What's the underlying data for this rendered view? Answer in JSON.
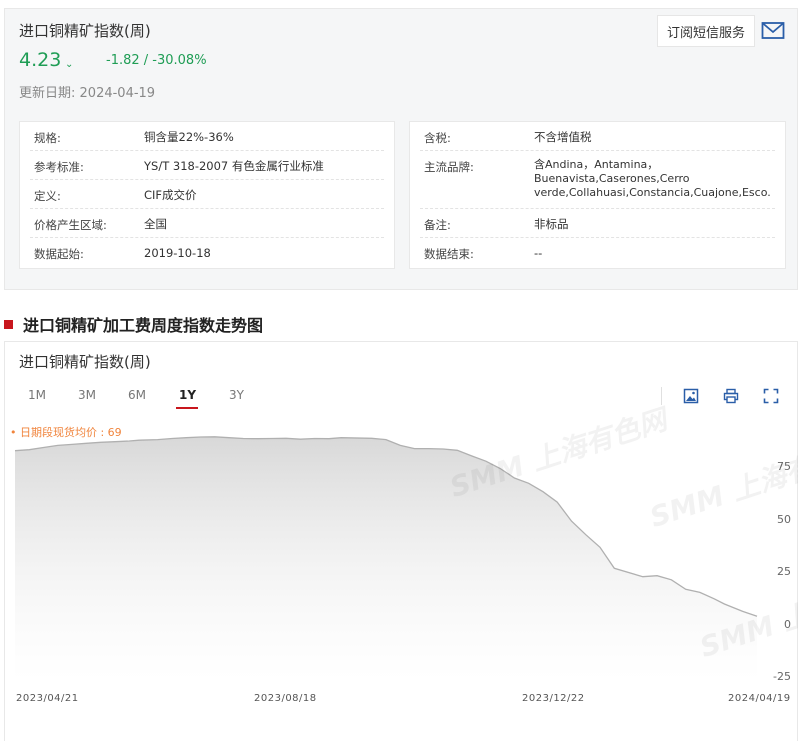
{
  "header": {
    "title": "进口铜精矿指数(周)",
    "price": "4.23",
    "change": "-1.82  /  -30.08%",
    "update_label": "更新日期:",
    "update_date": "2024-04-19",
    "subscribe_label": "订阅短信服务"
  },
  "info_left": [
    {
      "label": "规格:",
      "value": "铜含量22%-36%"
    },
    {
      "label": "参考标准:",
      "value": "YS/T 318-2007 有色金属行业标准"
    },
    {
      "label": "定义:",
      "value": "CIF成交价"
    },
    {
      "label": "价格产生区域:",
      "value": "全国"
    },
    {
      "label": "数据起始:",
      "value": "2019-10-18"
    }
  ],
  "info_right": [
    {
      "label": "含税:",
      "value": "不含增值税"
    },
    {
      "label": "主流品牌:",
      "value": "含Andina，Antamina，Buenavista,Caserones,Cerro verde,Collahuasi,Constancia,Cuajone,Esco..."
    },
    {
      "label": "备注:",
      "value": "非标品"
    },
    {
      "label": "数据结束:",
      "value": "--"
    }
  ],
  "section": {
    "title": "进口铜精矿加工费周度指数走势图"
  },
  "chart_panel": {
    "title": "进口铜精矿指数(周)",
    "ranges": [
      "1M",
      "3M",
      "6M",
      "1Y",
      "3Y"
    ],
    "active_range": "1Y",
    "avg_label": "• 日期段现货均价 : 69",
    "watermark": "SMM 上海有色网"
  },
  "icons": [
    "mail-icon",
    "image-download-icon",
    "print-icon",
    "fullscreen-icon"
  ],
  "colors": {
    "positive_change": "#1f9d55",
    "accent": "#c8161d",
    "avg_label": "#f0843c",
    "line": "#b0b0b0"
  },
  "chart_data": {
    "type": "area",
    "title": "进口铜精矿指数(周)",
    "x_ticks": [
      "2023/04/21",
      "2023/08/18",
      "2023/12/22",
      "2024/04/19"
    ],
    "y_ticks": [
      75,
      50,
      25,
      0,
      -25
    ],
    "ylim": [
      -25,
      90
    ],
    "grid": false,
    "average": 69,
    "x": [
      "2023-04-21",
      "2023-04-28",
      "2023-05-05",
      "2023-05-12",
      "2023-05-19",
      "2023-05-26",
      "2023-06-02",
      "2023-06-09",
      "2023-06-16",
      "2023-06-21",
      "2023-06-30",
      "2023-07-07",
      "2023-07-14",
      "2023-07-21",
      "2023-07-28",
      "2023-08-04",
      "2023-08-11",
      "2023-08-18",
      "2023-08-25",
      "2023-09-01",
      "2023-09-08",
      "2023-09-15",
      "2023-09-22",
      "2023-09-28",
      "2023-10-13",
      "2023-10-20",
      "2023-10-27",
      "2023-11-03",
      "2023-11-10",
      "2023-11-17",
      "2023-11-24",
      "2023-12-01",
      "2023-12-08",
      "2023-12-15",
      "2023-12-22",
      "2023-12-29",
      "2024-01-05",
      "2024-01-12",
      "2024-01-19",
      "2024-01-26",
      "2024-02-02",
      "2024-02-09",
      "2024-02-23",
      "2024-03-01",
      "2024-03-08",
      "2024-03-15",
      "2024-03-22",
      "2024-03-29",
      "2024-04-03",
      "2024-04-12",
      "2024-04-19"
    ],
    "values": [
      83,
      83.5,
      84.5,
      85.5,
      86,
      86.5,
      87,
      87.3,
      87.6,
      88,
      88.3,
      88.8,
      89.2,
      89.5,
      89.6,
      89.2,
      88.8,
      88.7,
      88.8,
      88.9,
      88.5,
      88.8,
      88.7,
      89.2,
      88.9,
      88.3,
      85.5,
      84,
      84,
      83.8,
      83.2,
      80.5,
      78,
      74.5,
      70,
      67.5,
      63.5,
      58.5,
      49.5,
      43,
      37,
      27,
      23,
      23.5,
      21.5,
      17,
      15.5,
      12.5,
      10,
      6.5,
      4.2
    ]
  }
}
